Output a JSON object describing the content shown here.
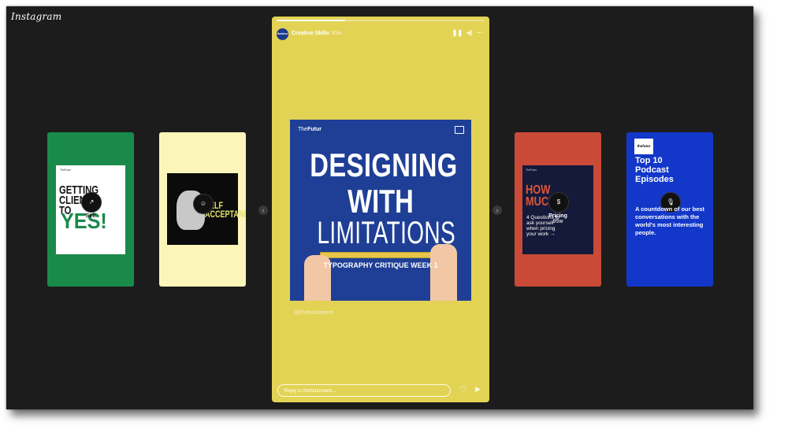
{
  "app": {
    "brand": "Instagram"
  },
  "side_stories": [
    {
      "id": "left-1",
      "bg": "#1a8a4a",
      "name": "Sell",
      "time": "",
      "thumb_title": "GETTING CLIENTS TO YES!"
    },
    {
      "id": "left-2",
      "bg": "#fbf5b9",
      "name": "",
      "time": "",
      "thumb_title": "SELF ACCEPTANCE"
    },
    {
      "id": "right-1",
      "bg": "#c94a37",
      "name": "Pricing",
      "time": "95w",
      "thumb_title": "HOW MUCH?",
      "thumb_sub": "4 Questions to ask yourself when pricing your work"
    },
    {
      "id": "right-2",
      "bg": "#1237c9",
      "name": "Podcasts",
      "time": "",
      "thumb_title": "Top 10 Podcast Episodes",
      "thumb_sub": "A countdown of our best conversations with the world's most interesting people."
    }
  ],
  "story": {
    "bg": "#e3d355",
    "progress": 0.33,
    "user": "Creative Skills",
    "avatar_label": "thefutur",
    "time": "95w",
    "post": {
      "logo_prefix": "The",
      "logo_suffix": "Futur",
      "line1": "DESIGNING",
      "line2": "WITH",
      "line3": "LIMITATIONS",
      "sub": "TYPOGRAPHY CRITIQUE WEEK 1",
      "bg": "#1f3f96"
    },
    "handle": "@thefuturishere",
    "reply_placeholder": "Reply to thefuturishere..."
  },
  "icons": {
    "pause": "pause-icon",
    "mute": "mute-icon",
    "more": "more-icon",
    "heart": "heart-icon",
    "send": "send-icon",
    "prev": "chevron-left-icon",
    "next": "chevron-right-icon"
  }
}
